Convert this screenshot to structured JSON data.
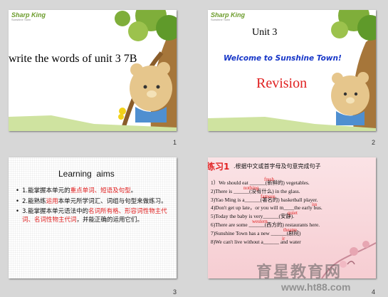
{
  "slides": [
    {
      "number": "1",
      "logo": "Sharp King",
      "logo_sub": "Sunshine Town",
      "title": "write the words of unit 3 7B"
    },
    {
      "number": "2",
      "logo": "Sharp King",
      "logo_sub": "Sunshine Town",
      "unit": "Unit 3",
      "subtitle": "Welcome to Sunshine Town!",
      "revision": "Revision"
    },
    {
      "number": "3",
      "heading": "Learning  aims",
      "aims": [
        {
          "plain": "1.能掌握本单元的",
          "red": "重点单词、短语及句型",
          "end": "。"
        },
        {
          "plain": "2.能熟练",
          "red": "运用",
          "end": "本单元所学词汇、词组与句型来做练习。"
        },
        {
          "plain": "3.能掌握本单元语法中的",
          "red": "名词所有格、形容词性物主代词、名词性物主代词",
          "end": "，并能正确的运用它们。"
        }
      ]
    },
    {
      "number": "4",
      "exercise_label": "练习1",
      "instruction": ".根据中文或首字母及句意完成句子",
      "lines": [
        {
          "text": "1）We should eat ______(新鲜的) vegetables.",
          "answer": "fresh"
        },
        {
          "text": "2)There is ______(没有什么) in the glass.",
          "answer": "nothing"
        },
        {
          "text": "3)Yao Ming is a______(著名的) basketball player.",
          "answer": "famous"
        },
        {
          "text": "4)Don't get up late，or you will m____the early bus.",
          "answer": "iss"
        },
        {
          "text": "5)Today the baby is very______(安静).",
          "answer": "quiet"
        },
        {
          "text": "6)There are some ______(西方的) restaurants here.",
          "answer": "western"
        },
        {
          "text": "7)Sunshine Town has a new ______(剧院)",
          "answer": "theatre"
        },
        {
          "text": "8)We can't live without a______ and water",
          "answer": "ir"
        }
      ]
    }
  ],
  "watermark": {
    "chinese": "育星教育网",
    "url": "www.ht88.com"
  }
}
